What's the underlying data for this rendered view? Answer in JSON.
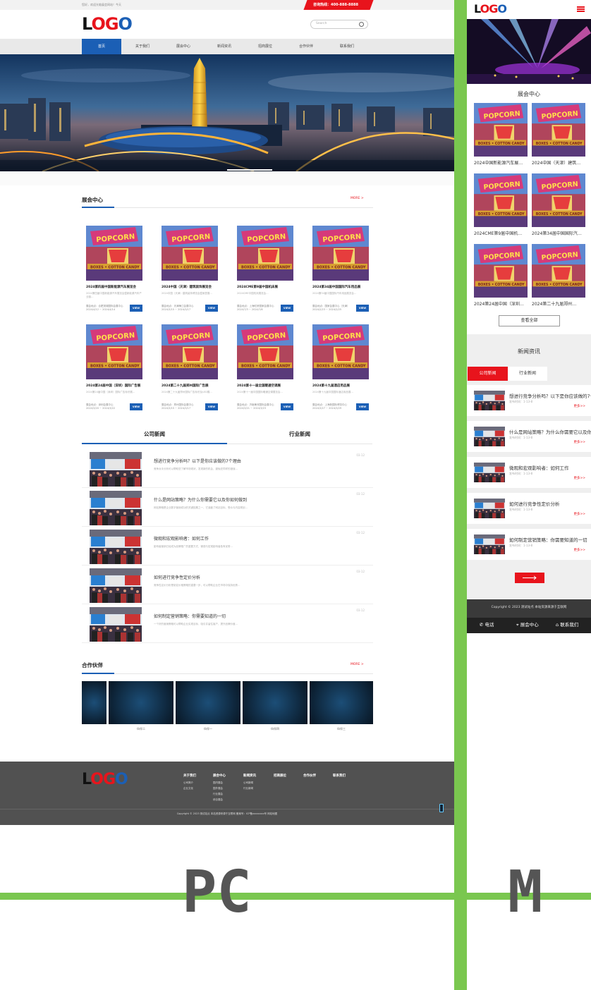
{
  "pc": {
    "topbar": {
      "welcome": "您好，欢迎光临展会网站！今天",
      "hotline": "咨询热线：400-888-8888"
    },
    "logo": {
      "l": "L",
      "o1": "O",
      "g": "G",
      "o2": "O"
    },
    "search": {
      "placeholder": "Search"
    },
    "nav": [
      "首页",
      "关于我们",
      "展会中心",
      "新闻资讯",
      "招商展位",
      "合作伙伴",
      "联系我们"
    ],
    "exhibition": {
      "title": "展会中心",
      "more": "MORE >",
      "cards": [
        {
          "title": "2024第四届中国新能源汽车展览会",
          "desc": "2024第四届中国新能源汽车展览会暨新能源汽车产业链…",
          "meta1": "展会地点：合肥滨湖国际会展中心",
          "meta2": "2024/4/12 ~ 2024/4/14",
          "btn": "VIEW"
        },
        {
          "title": "2024中国（天津）建筑装饰展览会",
          "desc": "2024中国（天津）建筑装饰博览会暨家居展…",
          "meta1": "展会地点：天津梅江会展中心",
          "meta2": "2024/3/15 ~ 2024/3/17",
          "btn": "VIEW"
        },
        {
          "title": "2024CME第9届中国机床展",
          "desc": "2024CME中国机床展览会…",
          "meta1": "展会地点：上海虹桥国家会展中心",
          "meta2": "2024/7/3 ~ 2024/7/6",
          "btn": "VIEW"
        },
        {
          "title": "2024第34届中国国际汽车用品展",
          "desc": "2024第34届中国国际汽车用品展览会…",
          "meta1": "展会地点：国家会展中心（天津）",
          "meta2": "2024/2/23 ~ 2024/2/25",
          "btn": "VIEW"
        },
        {
          "title": "2024第24届中国（深圳）国际广告展",
          "desc": "2024第24届中国（深圳）国际广告标识展…",
          "meta1": "展会地点：深圳会展中心",
          "meta2": "2024/3/20 ~ 2024/3/22",
          "btn": "VIEW"
        },
        {
          "title": "2024第二十九届郑州国际广告展",
          "desc": "2024第二十九届郑州国际广告标识及LED展…",
          "meta1": "展会地点：郑州国际会展中心",
          "meta2": "2024/3/15 ~ 2024/3/17",
          "btn": "VIEW"
        },
        {
          "title": "2024第十一届全国暖通空调展",
          "desc": "2024第十一届中国国际暖通空调展览会…",
          "meta1": "展会地点：济南黄河国际会展中心",
          "meta2": "2024/3/21 ~ 2024/3/23",
          "btn": "VIEW"
        },
        {
          "title": "2024第十九届酒店用品展",
          "desc": "2024第十九届中国国际酒店用品展…",
          "meta1": "展会地点：上海新国际博览中心",
          "meta2": "2024/3/27 ~ 2024/3/29",
          "btn": "VIEW"
        }
      ]
    },
    "news_tabs": [
      "公司新闻",
      "行业新闻"
    ],
    "news": [
      {
        "title": "想进行竞争分析吗？以下是你应该做的7个理由",
        "desc": "竞争对手分析可以帮助您了解市场现状，发现新的机会，避免犯同样的错误…",
        "date": "03-12"
      },
      {
        "title": "什么是网站策略？为什么你需要它以及你如何做到",
        "desc": "网站策略是企业数字营销成功的关键因素之一，它涵盖了网站目标、受众与内容规划…",
        "date": "03-12"
      },
      {
        "title": "微观和宏观影响者：如何工作",
        "desc": "影响者营销已经成为品牌推广的重要方式，微观与宏观影响者各有优势…",
        "date": "03-12"
      },
      {
        "title": "如何进行竞争性定价分析",
        "desc": "竞争性定价分析是制定价格策略的重要一步，可以帮助企业在市场中保持优势…",
        "date": "03-12"
      },
      {
        "title": "如何制定营销策略：你需要知道的一切",
        "desc": "一个好的营销策略可以帮助企业实现目标，吸引并留住客户，提升品牌价值…",
        "date": "03-12"
      }
    ],
    "partners": {
      "title": "合作伙伴",
      "more": "MORE >",
      "labels": [
        "伙伴二",
        "伙伴一",
        "伙伴四",
        "伙伴三"
      ]
    },
    "footer": {
      "cols": [
        {
          "title": "关于我们",
          "links": [
            "公司简介",
            "企业文化"
          ]
        },
        {
          "title": "展会中心",
          "links": [
            "国内展会",
            "国外展会",
            "行业展会",
            "综合展会"
          ]
        },
        {
          "title": "新闻资讯",
          "links": [
            "公司新闻",
            "行业新闻"
          ]
        },
        {
          "title": "招商展位",
          "links": []
        },
        {
          "title": "合作伙伴",
          "links": []
        },
        {
          "title": "联系我们",
          "links": []
        }
      ],
      "copyright": "Copyright © 2023 测试站点 本站资源来源于互联网 备案号：ICP备xxxxxxxx号 网站地图"
    },
    "label": "PC"
  },
  "mobile": {
    "exhibition_title": "展会中心",
    "cards": [
      "2024中国新能源汽车展…",
      "2024中国（天津）建筑…",
      "2024CME第9届中国机…",
      "2024第34届中国国际汽…",
      "2024第24届中国（深圳…",
      "2024第二十九届郑州…"
    ],
    "view_all": "查看全部",
    "news_title": "新闻资讯",
    "tabs": [
      "公司新闻",
      "行业新闻"
    ],
    "news": [
      {
        "title": "想进行竞争分析吗？以下是你应该做的7个理由",
        "date": "发布时间：1-13-8",
        "more": "更多>>"
      },
      {
        "title": "什么是网站策略？为什么你需要它以及你如何做到",
        "date": "发布时间：1-13-8",
        "more": "更多>>"
      },
      {
        "title": "微观和宏观影响者：如何工作",
        "date": "发布时间：1-13-8",
        "more": "更多>>"
      },
      {
        "title": "如何进行竞争性定价分析",
        "date": "发布时间：1-13-8",
        "more": "更多>>"
      },
      {
        "title": "如何制定营销策略：你需要知道的一切",
        "date": "发布时间：1-13-8",
        "more": "更多>>"
      }
    ],
    "copyright": "Copyright © 2023 测试站点 本站资源来源于互联网",
    "bottom_nav": [
      "电话",
      "展会中心",
      "联系我们"
    ],
    "label": "M"
  },
  "colors": {
    "accent_red": "#e8141c",
    "brand_blue": "#1b5fb5",
    "divider_green": "#7ac74f"
  }
}
